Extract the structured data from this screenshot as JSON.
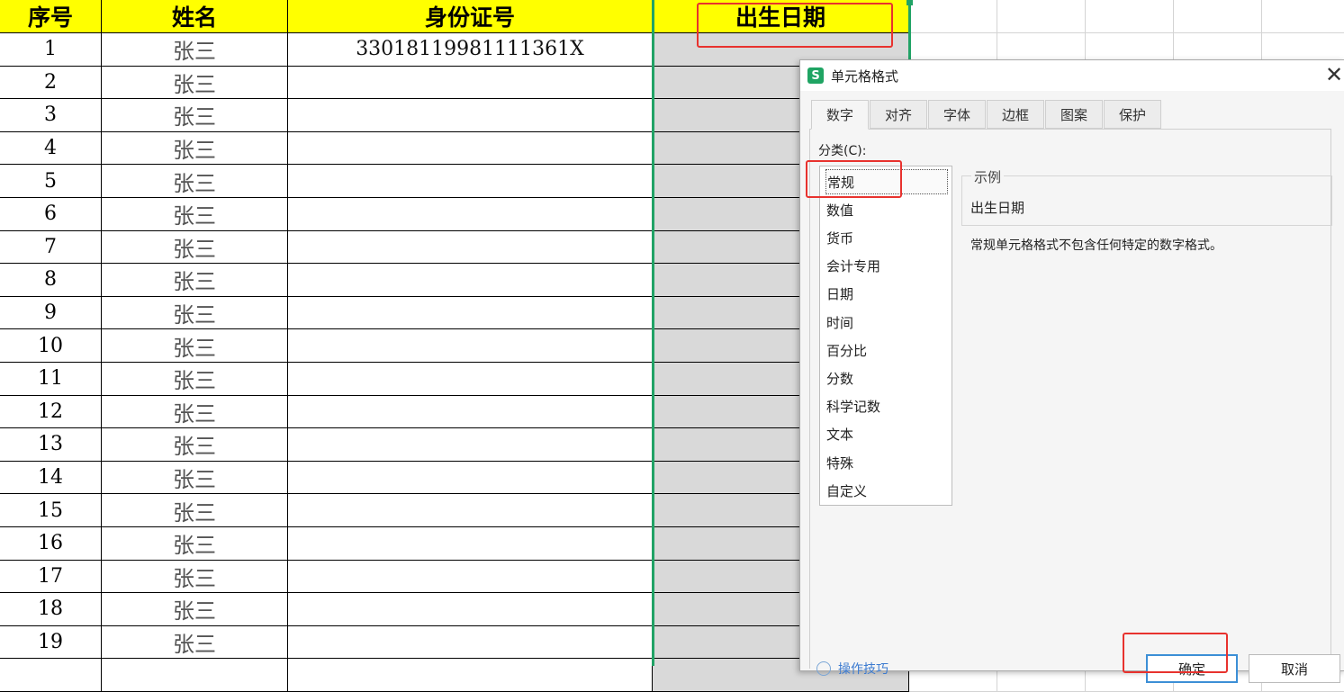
{
  "sheet": {
    "headers": [
      "序号",
      "姓名",
      "身份证号",
      "出生日期"
    ],
    "rows": [
      {
        "no": "1",
        "name": "张三",
        "id": "33018119981111361X"
      },
      {
        "no": "2",
        "name": "张三",
        "id": ""
      },
      {
        "no": "3",
        "name": "张三",
        "id": ""
      },
      {
        "no": "4",
        "name": "张三",
        "id": ""
      },
      {
        "no": "5",
        "name": "张三",
        "id": ""
      },
      {
        "no": "6",
        "name": "张三",
        "id": ""
      },
      {
        "no": "7",
        "name": "张三",
        "id": ""
      },
      {
        "no": "8",
        "name": "张三",
        "id": ""
      },
      {
        "no": "9",
        "name": "张三",
        "id": ""
      },
      {
        "no": "10",
        "name": "张三",
        "id": ""
      },
      {
        "no": "11",
        "name": "张三",
        "id": ""
      },
      {
        "no": "12",
        "name": "张三",
        "id": ""
      },
      {
        "no": "13",
        "name": "张三",
        "id": ""
      },
      {
        "no": "14",
        "name": "张三",
        "id": ""
      },
      {
        "no": "15",
        "name": "张三",
        "id": ""
      },
      {
        "no": "16",
        "name": "张三",
        "id": ""
      },
      {
        "no": "17",
        "name": "张三",
        "id": ""
      },
      {
        "no": "18",
        "name": "张三",
        "id": ""
      },
      {
        "no": "19",
        "name": "张三",
        "id": ""
      },
      {
        "no": "",
        "name": "",
        "id": ""
      }
    ],
    "header_fill": "#ffff00",
    "selection_color": "#21a366",
    "highlight_color": "#e8322e"
  },
  "dialog": {
    "title": "单元格格式",
    "app_icon": "S",
    "close_icon": "close-icon",
    "tabs": [
      "数字",
      "对齐",
      "字体",
      "边框",
      "图案",
      "保护"
    ],
    "active_tab": "数字",
    "category_label": "分类(C):",
    "categories": [
      "常规",
      "数值",
      "货币",
      "会计专用",
      "日期",
      "时间",
      "百分比",
      "分数",
      "科学记数",
      "文本",
      "特殊",
      "自定义"
    ],
    "selected_category": "常规",
    "sample_label": "示例",
    "sample_value": "出生日期",
    "description": "常规单元格格式不包含任何特定的数字格式。",
    "ok_label": "确定",
    "cancel_label": "取消",
    "help_link": "操作技巧"
  }
}
